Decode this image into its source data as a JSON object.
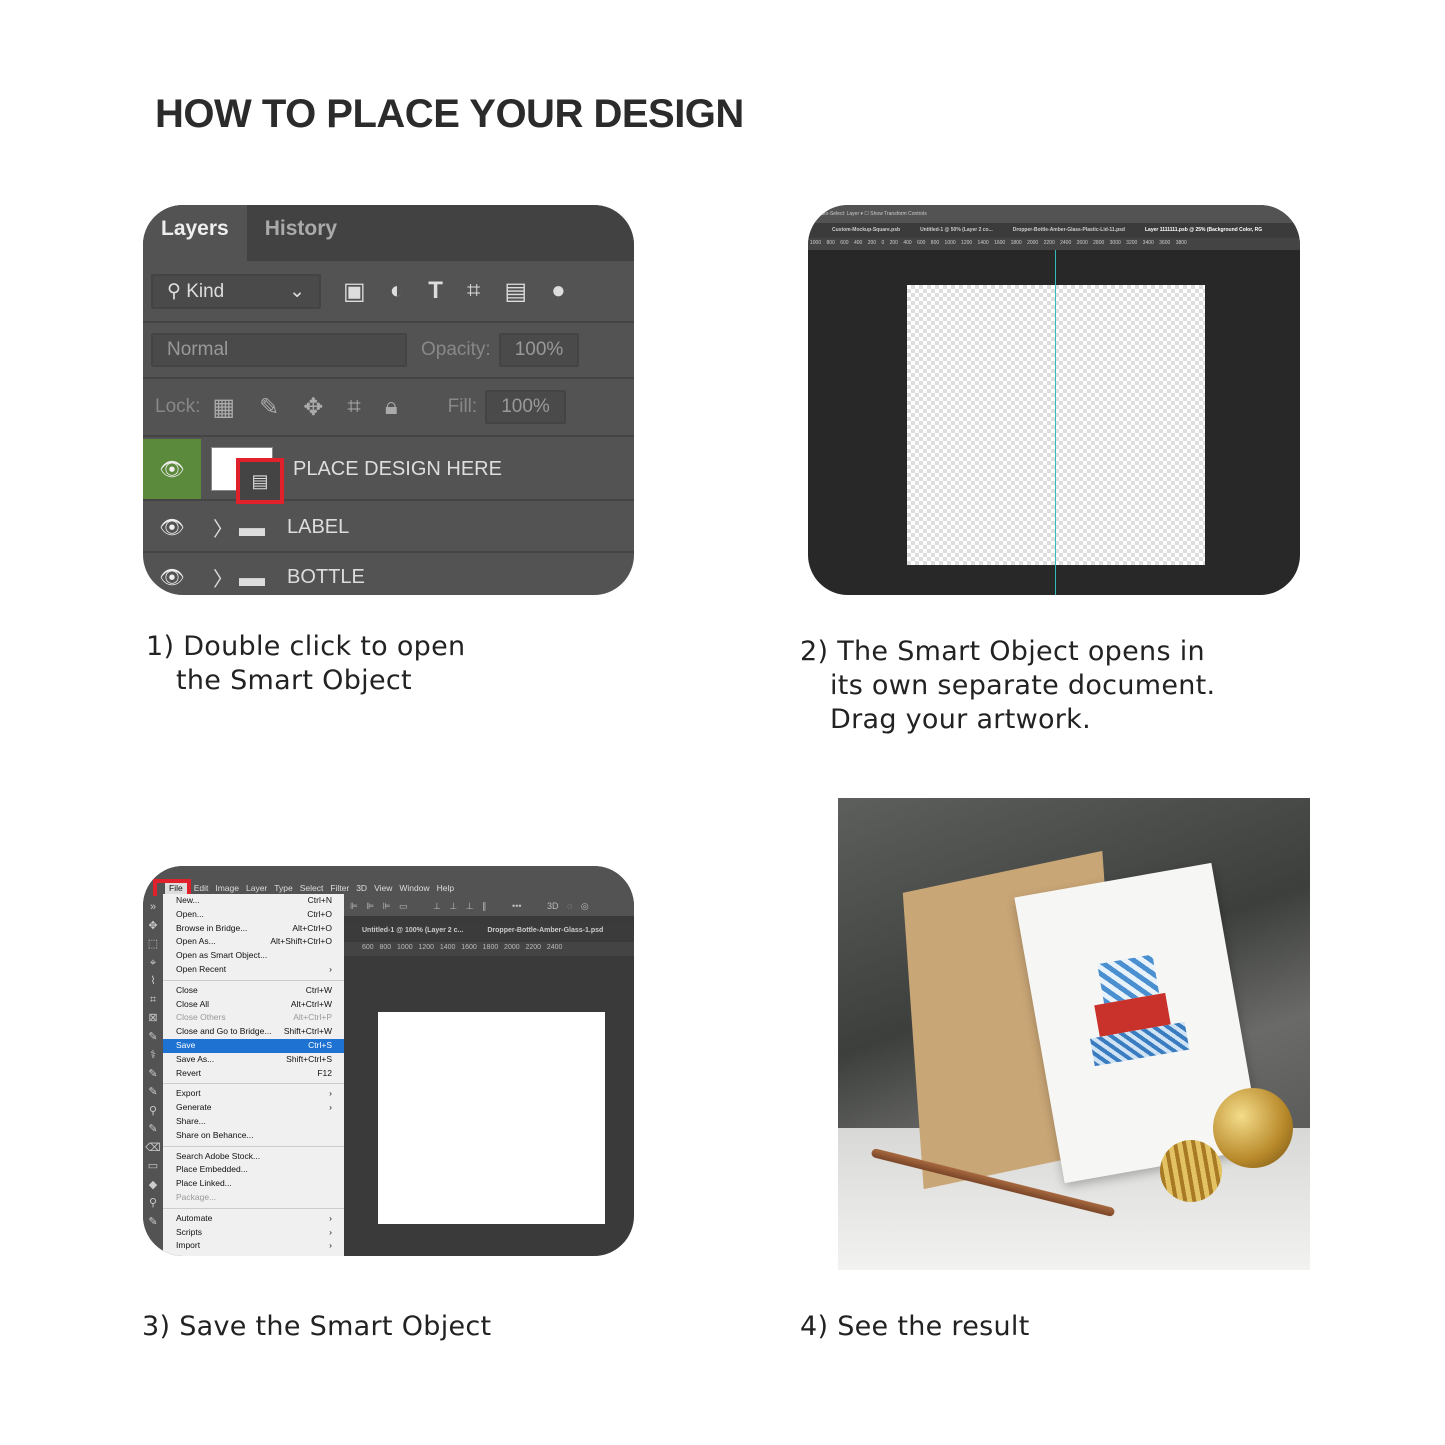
{
  "title": "HOW TO PLACE YOUR DESIGN",
  "step1": {
    "caption_line1": "1) Double click to open",
    "caption_line2": "the Smart Object",
    "tabs": [
      "Layers",
      "History"
    ],
    "kind": "Kind",
    "blend": "Normal",
    "opacity_label": "Opacity:",
    "opacity": "100%",
    "lock_label": "Lock:",
    "fill_label": "Fill:",
    "fill": "100%",
    "layers": [
      "PLACE DESIGN HERE",
      "LABEL",
      "BOTTLE"
    ],
    "accent": "#e0202a"
  },
  "step2": {
    "caption_line1": "2) The Smart Object opens in",
    "caption_line2": "its own separate document.",
    "caption_line3": "Drag your artwork.",
    "options": "Auto-Select:  Layer  ▾   ☐ Show Transform Controls",
    "doc_tabs": [
      "Custom-Mockup-Square.psb",
      "Untitled-1 @ 50% (Layer 2 co...",
      "Dropper-Bottle-Amber-Glass-Plastic-Lid-11.psd",
      "Layer 1111111.psb @ 25% (Background Color, RG"
    ],
    "ruler": "1000  800  600  400  200  0     200  400  600  800  1000  1200  1400  1600  1800  2000  2200  2400  2600  2800  3000  3200  3400  3600  3800"
  },
  "step3": {
    "caption": "3) Save the Smart Object",
    "menubar": [
      "File",
      "Edit",
      "Image",
      "Layer",
      "Type",
      "Select",
      "Filter",
      "3D",
      "View",
      "Window",
      "Help"
    ],
    "doc_tabs": [
      "Untitled-1 @ 100% (Layer 2 c...",
      "Dropper-Bottle-Amber-Glass-1.psd"
    ],
    "ruler": "600   800   1000   1200   1400   1600   1800   2000   2200   2400",
    "menu": [
      [
        {
          "label": "New...",
          "key": "Ctrl+N"
        },
        {
          "label": "Open...",
          "key": "Ctrl+O"
        },
        {
          "label": "Browse in Bridge...",
          "key": "Alt+Ctrl+O"
        },
        {
          "label": "Open As...",
          "key": "Alt+Shift+Ctrl+O"
        },
        {
          "label": "Open as Smart Object...",
          "key": ""
        },
        {
          "label": "Open Recent",
          "key": "›"
        }
      ],
      [
        {
          "label": "Close",
          "key": "Ctrl+W"
        },
        {
          "label": "Close All",
          "key": "Alt+Ctrl+W"
        },
        {
          "label": "Close Others",
          "key": "Alt+Ctrl+P",
          "disabled": true
        },
        {
          "label": "Close and Go to Bridge...",
          "key": "Shift+Ctrl+W"
        },
        {
          "label": "Save",
          "key": "Ctrl+S",
          "selected": true
        },
        {
          "label": "Save As...",
          "key": "Shift+Ctrl+S"
        },
        {
          "label": "Revert",
          "key": "F12"
        }
      ],
      [
        {
          "label": "Export",
          "key": "›"
        },
        {
          "label": "Generate",
          "key": "›"
        },
        {
          "label": "Share...",
          "key": ""
        },
        {
          "label": "Share on Behance...",
          "key": ""
        }
      ],
      [
        {
          "label": "Search Adobe Stock...",
          "key": ""
        },
        {
          "label": "Place Embedded...",
          "key": ""
        },
        {
          "label": "Place Linked...",
          "key": ""
        },
        {
          "label": "Package...",
          "key": "",
          "disabled": true
        }
      ],
      [
        {
          "label": "Automate",
          "key": "›"
        },
        {
          "label": "Scripts",
          "key": "›"
        },
        {
          "label": "Import",
          "key": "›"
        }
      ]
    ]
  },
  "step4": {
    "caption": "4) See the result"
  }
}
